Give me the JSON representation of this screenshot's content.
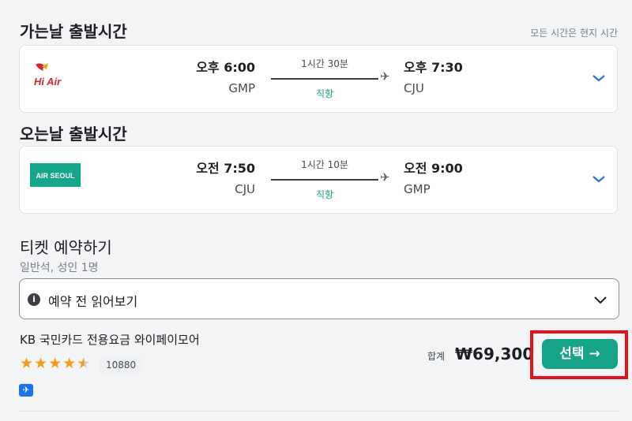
{
  "outbound": {
    "section_title": "가는날 출발시간",
    "airline_logo_text": "Hi Air",
    "dep_time": "오후 6:00",
    "dep_code": "GMP",
    "duration": "1시간 30분",
    "stops": "직항",
    "arr_time": "오후 7:30",
    "arr_code": "CJU"
  },
  "timezone_note": "모든 시간은 현지 시간",
  "inbound": {
    "section_title": "오는날 출발시간",
    "airline_logo_text": "AIR SEOUL",
    "dep_time": "오전 7:50",
    "dep_code": "CJU",
    "duration": "1시간 10분",
    "stops": "직항",
    "arr_time": "오전 9:00",
    "arr_code": "GMP"
  },
  "ticket": {
    "title": "티켓 예약하기",
    "subtitle": "일반석, 성인 1명",
    "dropdown_label": "예약 전 읽어보기"
  },
  "offer": {
    "provider": "KB 국민카드 전용요금 와이페이모어",
    "rating": 4.5,
    "review_count": "10880",
    "total_label": "합계",
    "price": "₩69,300",
    "select_label": "선택 →"
  },
  "colors": {
    "accent": "#17a38a",
    "highlight": "#e8111b",
    "link_blue": "#1a73e8"
  }
}
